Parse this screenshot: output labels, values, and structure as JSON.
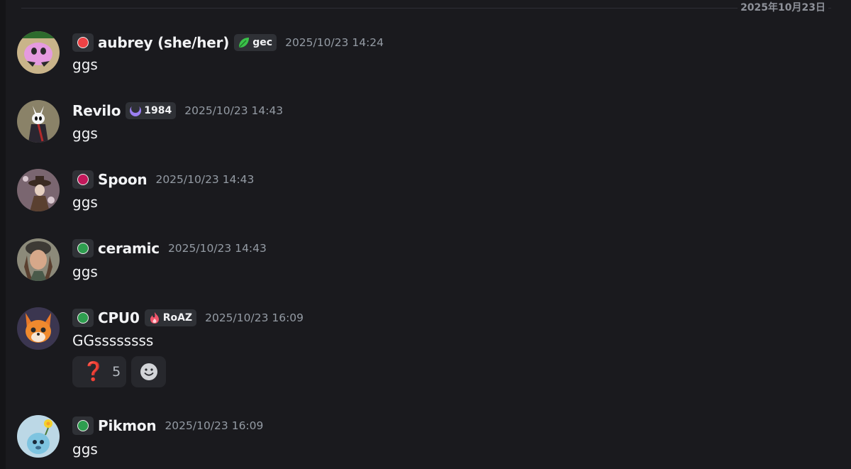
{
  "date_divider": "2025年10月23日",
  "messages": [
    {
      "username": "aubrey (she/her)",
      "role_color": "#ed4245",
      "clan_tag": {
        "icon": "green-leaf-icon",
        "label": "gec"
      },
      "timestamp": "2025/10/23 14:24",
      "text": "ggs"
    },
    {
      "username": "Revilo",
      "clan_tag": {
        "icon": "purple-moon-icon",
        "label": "1984"
      },
      "timestamp": "2025/10/23 14:43",
      "text": "ggs"
    },
    {
      "username": "Spoon",
      "role_color": "#c2185b",
      "timestamp": "2025/10/23 14:43",
      "text": "ggs"
    },
    {
      "username": "ceramic",
      "role_color": "#2e9e4f",
      "timestamp": "2025/10/23 14:43",
      "text": "ggs"
    },
    {
      "username": "CPU0",
      "role_color": "#2e9e4f",
      "clan_tag": {
        "icon": "flame-icon",
        "label": "RoAZ"
      },
      "timestamp": "2025/10/23 16:09",
      "text": "GGssssssss",
      "reactions": [
        {
          "emoji": "❓",
          "icon": "red-question-mark-icon",
          "count": "5"
        }
      ],
      "add_reaction_icon": "add-reaction-smiley-icon"
    },
    {
      "username": "Pikmon",
      "role_color": "#2e9e4f",
      "timestamp": "2025/10/23 16:09",
      "text": "ggs"
    }
  ]
}
